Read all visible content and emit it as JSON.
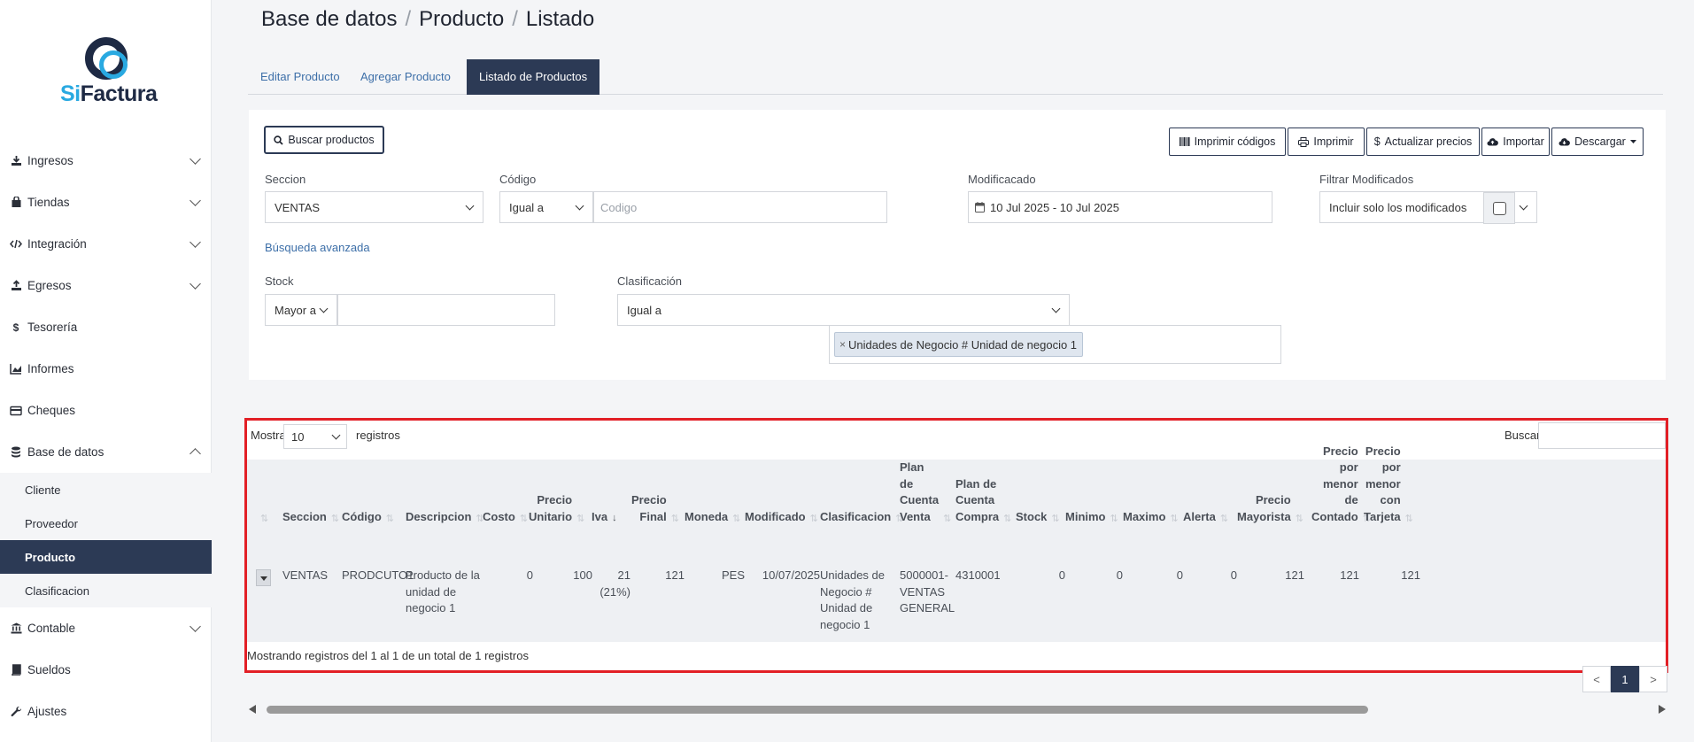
{
  "logo": {
    "part1": "Si",
    "part2": "Factura"
  },
  "sidebar": {
    "items": [
      {
        "label": "Ingresos"
      },
      {
        "label": "Tiendas"
      },
      {
        "label": "Integración"
      },
      {
        "label": "Egresos"
      },
      {
        "label": "Tesorería"
      },
      {
        "label": "Informes"
      },
      {
        "label": "Cheques"
      },
      {
        "label": "Base de datos"
      },
      {
        "label": "Contable"
      },
      {
        "label": "Sueldos"
      },
      {
        "label": "Ajustes"
      }
    ],
    "sub_items": [
      {
        "label": "Cliente"
      },
      {
        "label": "Proveedor"
      },
      {
        "label": "Producto"
      },
      {
        "label": "Clasificacion"
      }
    ]
  },
  "breadcrumb": {
    "level1": "Base de datos",
    "level2": "Producto",
    "level3": "Listado",
    "separator": "/"
  },
  "tabs": [
    {
      "label": "Editar Producto"
    },
    {
      "label": "Agregar Producto"
    },
    {
      "label": "Listado de Productos"
    }
  ],
  "toolbar": {
    "search_label": "Buscar productos",
    "print_codes_label": "Imprimir códigos",
    "print_label": "Imprimir",
    "update_prices_label": "Actualizar precios",
    "import_label": "Importar",
    "download_label": "Descargar"
  },
  "filters": {
    "seccion": {
      "label": "Seccion",
      "value": "VENTAS"
    },
    "codigo": {
      "label": "Código",
      "operator": "Igual a",
      "placeholder": "Codigo"
    },
    "modificado": {
      "label": "Modificacado",
      "value": "10 Jul 2025 - 10 Jul 2025"
    },
    "filtrar": {
      "label": "Filtrar Modificados",
      "value": "Incluir solo los modificados"
    },
    "advanced_link": "Búsqueda avanzada",
    "stock": {
      "label": "Stock",
      "operator": "Mayor a",
      "value": ""
    },
    "clasificacion": {
      "label": "Clasificación",
      "operator": "Igual a",
      "tag": "Unidades de Negocio # Unidad de negocio 1",
      "tag_remove": "×"
    }
  },
  "table": {
    "show_label": "Mostrar",
    "page_size": "10",
    "records_label": "registros",
    "search_label": "Buscar:",
    "search_value": "",
    "columns": [
      [
        "Seccion"
      ],
      [
        "Código"
      ],
      [
        "Descripcion"
      ],
      [
        "Costo"
      ],
      [
        "Precio",
        "Unitario"
      ],
      [
        "Iva"
      ],
      [
        "Precio",
        "Final"
      ],
      [
        "Moneda"
      ],
      [
        "Modificado"
      ],
      [
        "Clasificacion"
      ],
      [
        "Plan",
        "de",
        "Cuenta",
        "Venta"
      ],
      [
        "Plan de",
        "Cuenta",
        "Compra"
      ],
      [
        "Stock"
      ],
      [
        "Minimo"
      ],
      [
        "Maximo"
      ],
      [
        "Alerta"
      ],
      [
        "Precio",
        "Mayorista"
      ],
      [
        "Precio",
        "por",
        "menor",
        "de",
        "Contado"
      ],
      [
        "Precio",
        "por",
        "menor",
        "con",
        "Tarjeta"
      ]
    ],
    "rows": [
      [
        [
          "VENTAS"
        ],
        [
          "PRODCUTO1"
        ],
        [
          "Producto de la",
          "unidad de",
          "negocio 1"
        ],
        [
          "0"
        ],
        [
          "100"
        ],
        [
          "21",
          "(21%)"
        ],
        [
          "121"
        ],
        [
          "PES"
        ],
        [
          "10/07/2025"
        ],
        [
          "Unidades de",
          "Negocio #",
          "Unidad de",
          "negocio 1"
        ],
        [
          "5000001-",
          "VENTAS",
          "GENERAL"
        ],
        [
          "4310001"
        ],
        [
          "0"
        ],
        [
          "0"
        ],
        [
          "0"
        ],
        [
          "0"
        ],
        [
          "121"
        ],
        [
          "121"
        ],
        [
          "121"
        ]
      ]
    ],
    "info": "Mostrando registros del 1 al 1 de un total de 1 registros",
    "pagination": {
      "prev": "<",
      "current": "1",
      "next": ">"
    }
  },
  "icons": {
    "sort": "⇅",
    "sort_active": "↓"
  },
  "colors": {
    "primary": "#2c3a55",
    "link": "#3d6fa8",
    "accent": "#29a9e1",
    "highlight_border": "#e21f26"
  }
}
